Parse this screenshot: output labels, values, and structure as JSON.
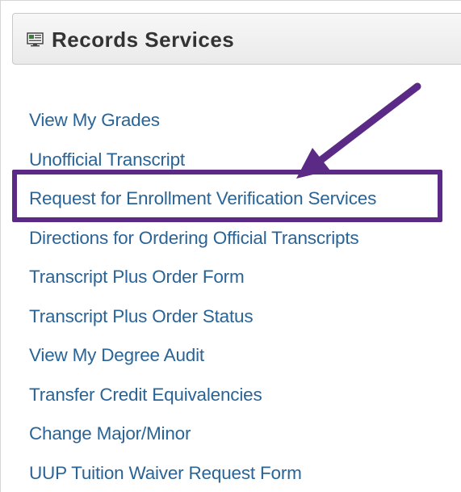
{
  "panel": {
    "title": "Records Services",
    "icon": "monitor-icon"
  },
  "links": [
    {
      "id": "view-my-grades",
      "label": "View My Grades"
    },
    {
      "id": "unofficial-transcript",
      "label": "Unofficial Transcript"
    },
    {
      "id": "request-enrollment-verification",
      "label": "Request for Enrollment Verification Services"
    },
    {
      "id": "directions-ordering-official-transcripts",
      "label": "Directions for Ordering Official Transcripts"
    },
    {
      "id": "transcript-plus-order-form",
      "label": "Transcript Plus Order Form"
    },
    {
      "id": "transcript-plus-order-status",
      "label": "Transcript Plus Order Status"
    },
    {
      "id": "view-my-degree-audit",
      "label": "View My Degree Audit"
    },
    {
      "id": "transfer-credit-equivalencies",
      "label": "Transfer Credit Equivalencies"
    },
    {
      "id": "change-major-minor",
      "label": "Change Major/Minor"
    },
    {
      "id": "uup-tuition-waiver-request-form",
      "label": "UUP Tuition Waiver Request Form"
    }
  ],
  "annotation": {
    "highlighted_link": "Request for Enrollment Verification Services",
    "color": "#5b2a86"
  },
  "colors": {
    "link": "#2a6496",
    "header_text": "#333333",
    "annotation": "#5b2a86"
  }
}
